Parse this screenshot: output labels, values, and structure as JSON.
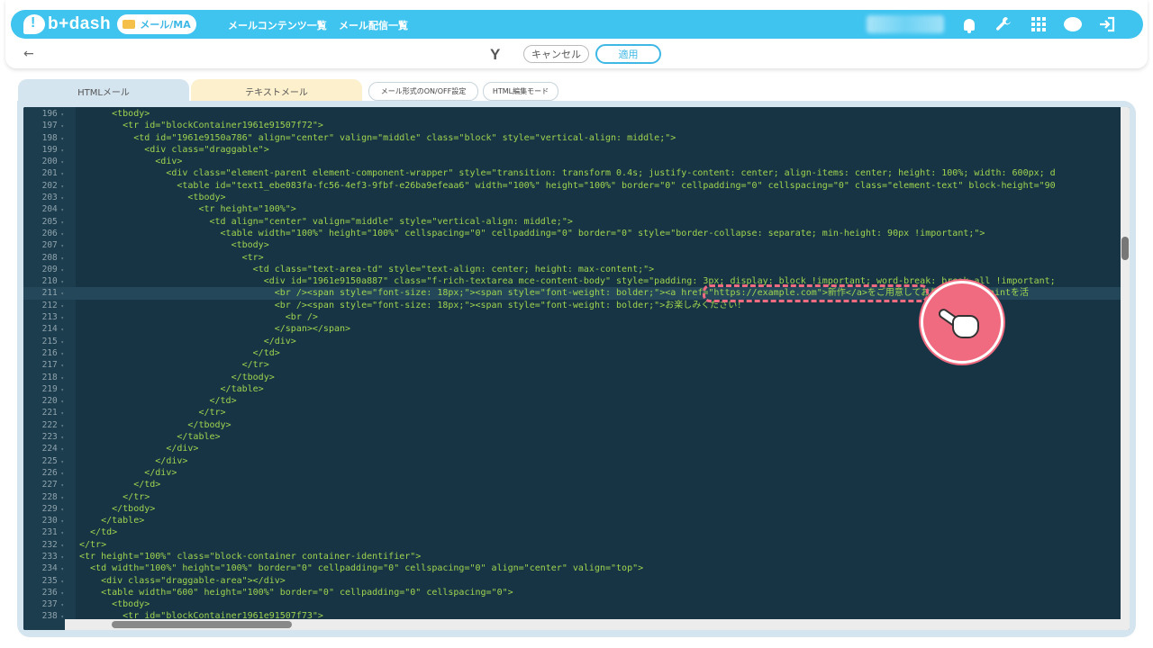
{
  "header": {
    "logo": "b+dash",
    "mail_pill": "メール/MA",
    "nav": [
      "メールコンテンツ一覧",
      "メール配信一覧"
    ],
    "icons": [
      "bell-icon",
      "wrench-icon",
      "apps-grid-icon",
      "support-face-icon",
      "logout-icon"
    ]
  },
  "toolbar": {
    "back_icon": "arrow-left-icon",
    "filter_icon": "merge-tag-icon",
    "cancel_label": "キャンセル",
    "apply_label": "適用"
  },
  "tabs": {
    "html": "HTMLメール",
    "text": "テキストメール",
    "toggle_format": "メール形式のON/OFF設定",
    "html_mode": "HTML編集モード"
  },
  "editor": {
    "active_line": 211,
    "lines": [
      {
        "n": 196,
        "code": "      <tbody>"
      },
      {
        "n": 197,
        "code": "        <tr id=\"blockContainer1961e91507f72\">"
      },
      {
        "n": 198,
        "code": "          <td id=\"1961e9150a786\" align=\"center\" valign=\"middle\" class=\"block\" style=\"vertical-align: middle;\">"
      },
      {
        "n": 199,
        "code": "            <div class=\"draggable\">"
      },
      {
        "n": 200,
        "code": "              <div>"
      },
      {
        "n": 201,
        "code": "                <div class=\"element-parent element-component-wrapper\" style=\"transition: transform 0.4s; justify-content: center; align-items: center; height: 100%; width: 600px; d"
      },
      {
        "n": 202,
        "code": "                  <table id=\"text1_ebe083fa-fc56-4ef3-9fbf-e26ba9efeaa6\" width=\"100%\" height=\"100%\" border=\"0\" cellpadding=\"0\" cellspacing=\"0\" class=\"element-text\" block-height=\"90"
      },
      {
        "n": 203,
        "code": "                    <tbody>"
      },
      {
        "n": 204,
        "code": "                      <tr height=\"100%\">"
      },
      {
        "n": 205,
        "code": "                        <td align=\"center\" valign=\"middle\" style=\"vertical-align: middle;\">"
      },
      {
        "n": 206,
        "code": "                          <table width=\"100%\" height=\"100%\" cellspacing=\"0\" cellpadding=\"0\" border=\"0\" style=\"border-collapse: separate; min-height: 90px !important;\">"
      },
      {
        "n": 207,
        "code": "                            <tbody>"
      },
      {
        "n": 208,
        "code": "                              <tr>"
      },
      {
        "n": 209,
        "code": "                                <td class=\"text-area-td\" style=\"text-align: center; height: max-content;\">"
      },
      {
        "n": 210,
        "code": "                                  <div id=\"1961e9150a887\" class=\"f-rich-textarea mce-content-body\" style=\"padding: 3px; display: block !important; word-break: break-all !important;"
      },
      {
        "n": 211,
        "code": "                                    <br /><span style=\"font-size: 18px;\"><span style=\"font-weight: bolder;\"><a href=\"https://example.com\">新作</a>をご用意しておりますので、pointを活"
      },
      {
        "n": 212,
        "code": "                                    <br /><span style=\"font-size: 18px;\"><span style=\"font-weight: bolder;\">お楽しみください！"
      },
      {
        "n": 213,
        "code": "                                      <br />"
      },
      {
        "n": 214,
        "code": "                                    </span></span>"
      },
      {
        "n": 215,
        "code": "                                  </div>"
      },
      {
        "n": 216,
        "code": "                                </td>"
      },
      {
        "n": 217,
        "code": "                              </tr>"
      },
      {
        "n": 218,
        "code": "                            </tbody>"
      },
      {
        "n": 219,
        "code": "                          </table>"
      },
      {
        "n": 220,
        "code": "                        </td>"
      },
      {
        "n": 221,
        "code": "                      </tr>"
      },
      {
        "n": 222,
        "code": "                    </tbody>"
      },
      {
        "n": 223,
        "code": "                  </table>"
      },
      {
        "n": 224,
        "code": "                </div>"
      },
      {
        "n": 225,
        "code": "              </div>"
      },
      {
        "n": 226,
        "code": "            </div>"
      },
      {
        "n": 227,
        "code": "          </td>"
      },
      {
        "n": 228,
        "code": "        </tr>"
      },
      {
        "n": 229,
        "code": "      </tbody>"
      },
      {
        "n": 230,
        "code": "    </table>"
      },
      {
        "n": 231,
        "code": "  </td>"
      },
      {
        "n": 232,
        "code": "</tr>"
      },
      {
        "n": 233,
        "code": "<tr height=\"100%\" class=\"block-container container-identifier\">"
      },
      {
        "n": 234,
        "code": "  <td width=\"100%\" height=\"100%\" border=\"0\" cellpadding=\"0\" cellspacing=\"0\" align=\"center\" valign=\"top\">"
      },
      {
        "n": 235,
        "code": "    <div class=\"draggable-area\"></div>"
      },
      {
        "n": 236,
        "code": "    <table width=\"600\" height=\"100%\" border=\"0\" cellpadding=\"0\" cellspacing=\"0\">"
      },
      {
        "n": 237,
        "code": "      <tbody>"
      },
      {
        "n": 238,
        "code": "        <tr id=\"blockContainer1961e91507f73\">"
      }
    ]
  },
  "annotation": {
    "highlight": "dashed-highlight-box",
    "pointer_icon": "pointing-hand-icon"
  },
  "colors": {
    "accent": "#3fc4f0",
    "editor_bg": "#163444",
    "code_text": "#9fd44f",
    "annotation": "#f06a80"
  }
}
